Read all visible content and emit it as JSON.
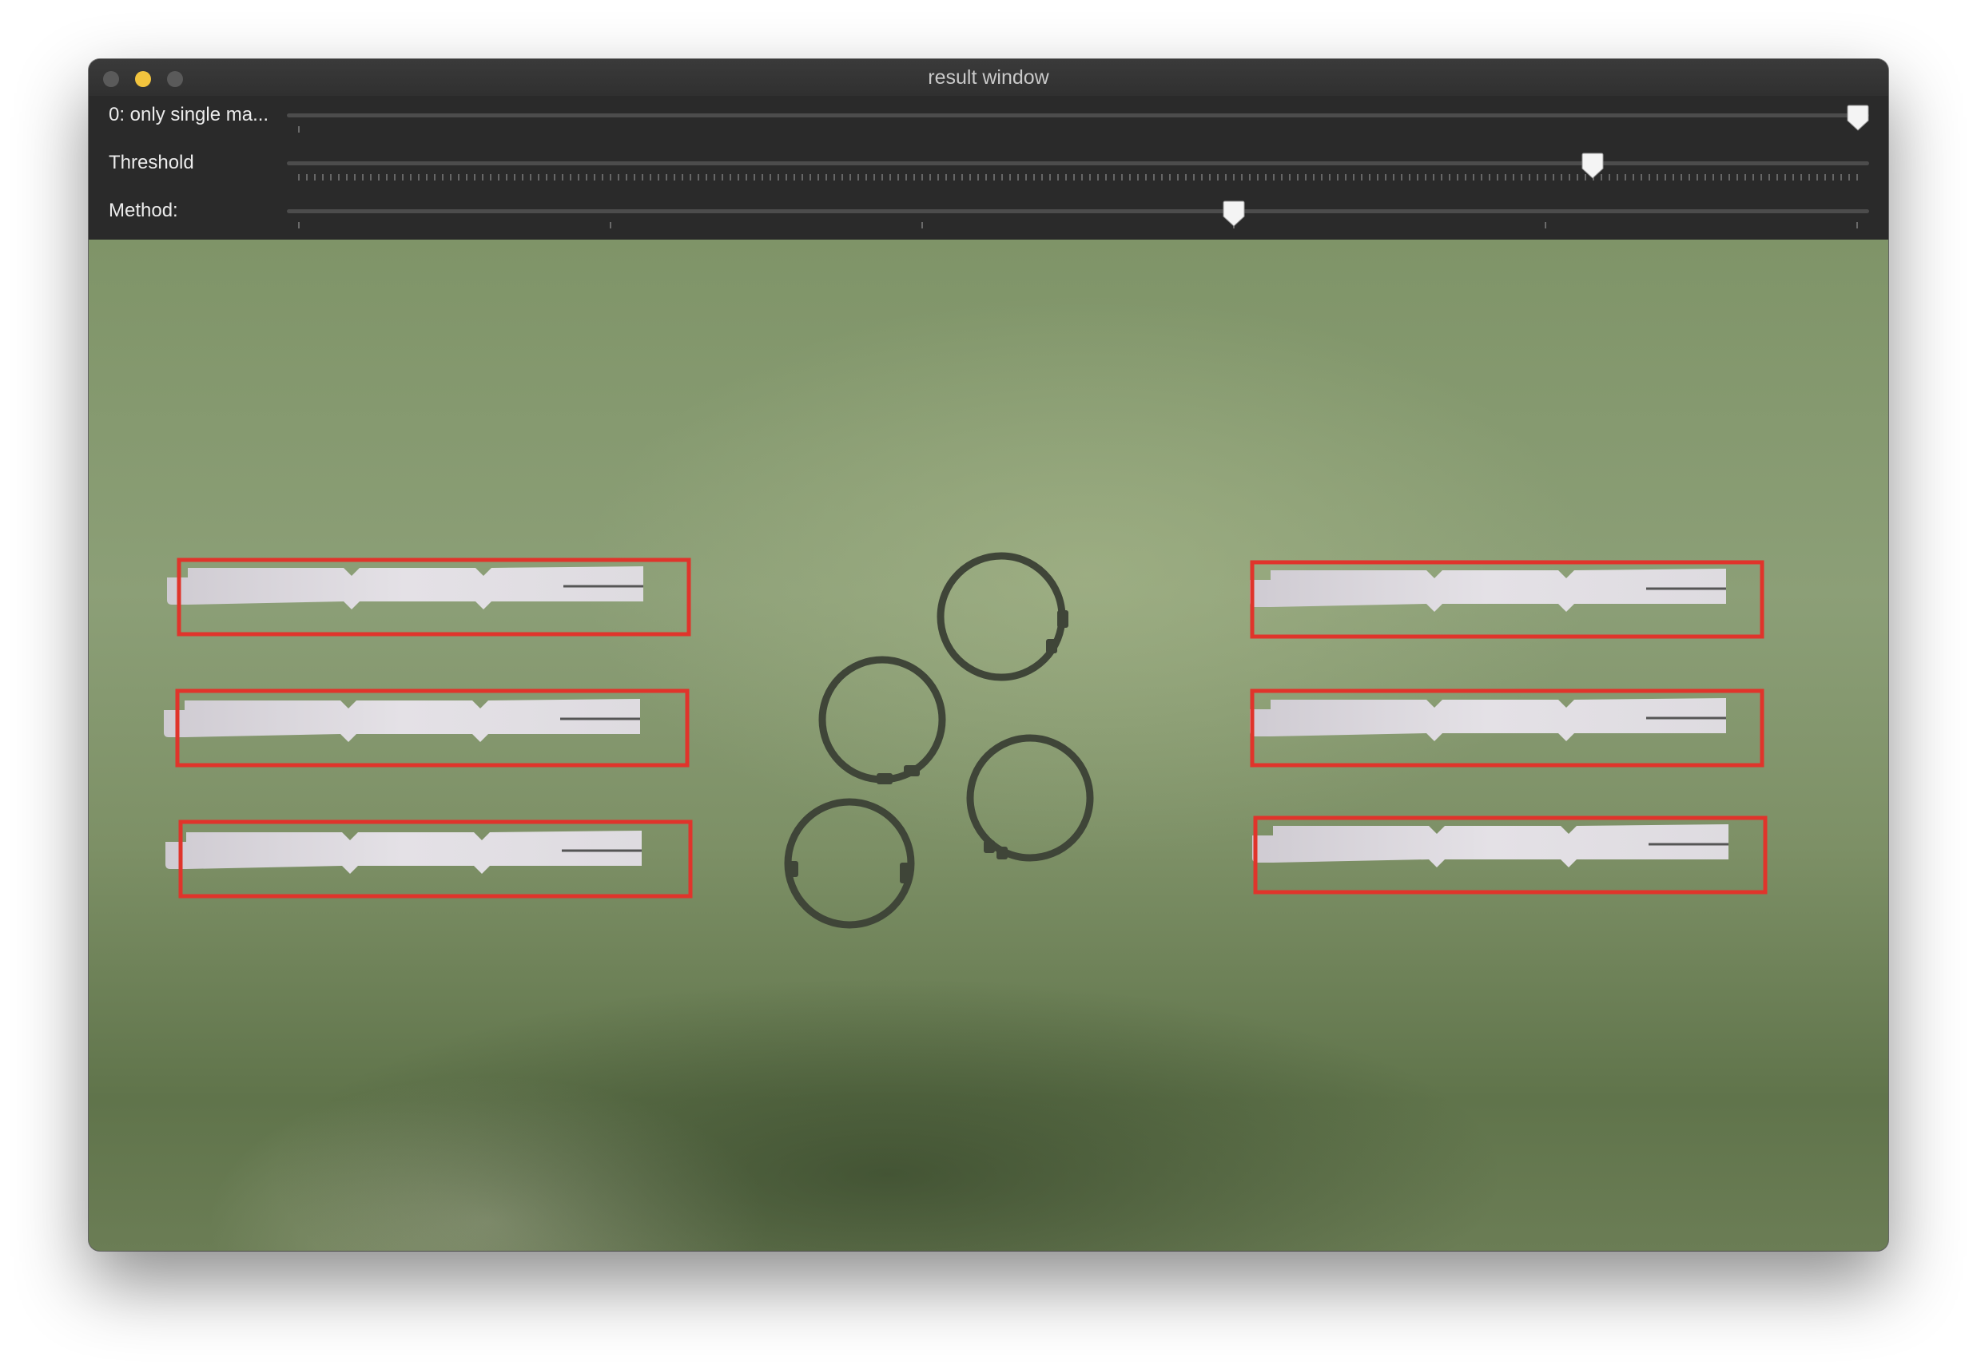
{
  "window": {
    "title": "result window"
  },
  "trackbars": [
    {
      "label": "0: only single ma...",
      "value_fraction": 1.0,
      "tick_style": "single"
    },
    {
      "label": "Threshold",
      "value_fraction": 0.83,
      "tick_style": "fine"
    },
    {
      "label": "Method:",
      "value_fraction": 0.6,
      "tick_style": "major"
    }
  ],
  "image_view": {
    "description_tags": [
      "green-mat-background",
      "metal-strips",
      "circlip-rings"
    ],
    "detection_box_color": "#e0342b",
    "detections_count": 6
  }
}
